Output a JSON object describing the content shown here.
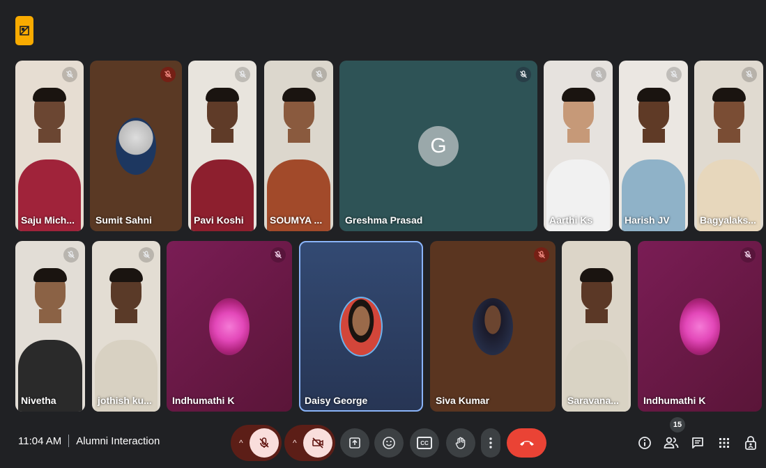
{
  "top_icon": "cast-off-icon",
  "tiles_row1": [
    {
      "name": "Saju Mich...",
      "bg": "#e6ddd2",
      "shirt": "#a0233a",
      "skin": "#6b4632",
      "muted": "ghost"
    },
    {
      "name": "Sumit Sahni",
      "bg": "#5a3924",
      "type": "avatar",
      "muted": "red"
    },
    {
      "name": "Pavi Koshi",
      "bg": "#e8e4dd",
      "shirt": "#8d1f2e",
      "skin": "#5f3b28",
      "muted": "ghost"
    },
    {
      "name": "SOUMYA ...",
      "bg": "#dcd7cd",
      "shirt": "#a24a2a",
      "skin": "#8a5a3e",
      "muted": "ghost"
    },
    {
      "name": "Greshma Prasad",
      "bg": "#2e5356",
      "type": "letter",
      "letter": "G",
      "muted": "dark"
    },
    {
      "name": "Aarthi Ks",
      "bg": "#e6e2de",
      "shirt": "#f1f1f1",
      "skin": "#c69978",
      "muted": "ghost"
    },
    {
      "name": "Harish JV",
      "bg": "#ebe7e2",
      "shirt": "#8fb2c8",
      "skin": "#5f3a26",
      "muted": "ghost"
    },
    {
      "name": "Bagyalaks...",
      "bg": "#e0dad0",
      "shirt": "#e7d7bc",
      "skin": "#7a4d34",
      "muted": "ghost"
    }
  ],
  "tiles_row2": [
    {
      "name": "Nivetha",
      "bg": "#e2ddd6",
      "shirt": "#2a2a2a",
      "skin": "#8b6245",
      "muted": "ghost"
    },
    {
      "name": "jothish ku...",
      "bg": "#e3ddd3",
      "shirt": "#d8d1c2",
      "skin": "#5a3a28",
      "muted": "ghost"
    },
    {
      "name": "Indhumathi K",
      "bg": "#6d1c4a",
      "type": "flower",
      "muted": "pinkish"
    },
    {
      "name": "Daisy George",
      "bg": "#2e3f63",
      "type": "avatar2",
      "muted": "none",
      "active": true
    },
    {
      "name": "Siva Kumar",
      "bg": "#5a3520",
      "type": "avatar3",
      "muted": "red"
    },
    {
      "name": "Saravana...",
      "bg": "#dcd5c8",
      "shirt": "#d9d3c4",
      "skin": "#5b3826",
      "muted": "none"
    },
    {
      "name": "Indhumathi K",
      "bg": "#6d1c4a",
      "type": "flower",
      "muted": "pinkish"
    }
  ],
  "bottom": {
    "time": "11:04 AM",
    "meeting": "Alumni Interaction",
    "participants_count": "15"
  },
  "controls": {
    "mic": "mic-off-icon",
    "cam": "videocam-off-icon",
    "present": "present-icon",
    "emoji": "emoji-icon",
    "captions_label": "CC",
    "raise": "hand-icon",
    "more": "more-vert-icon",
    "leave": "call-end-icon"
  },
  "colors": {
    "accent": "#8ab4f8",
    "leave": "#ea4335",
    "muted_pill": "#5c1e17"
  }
}
